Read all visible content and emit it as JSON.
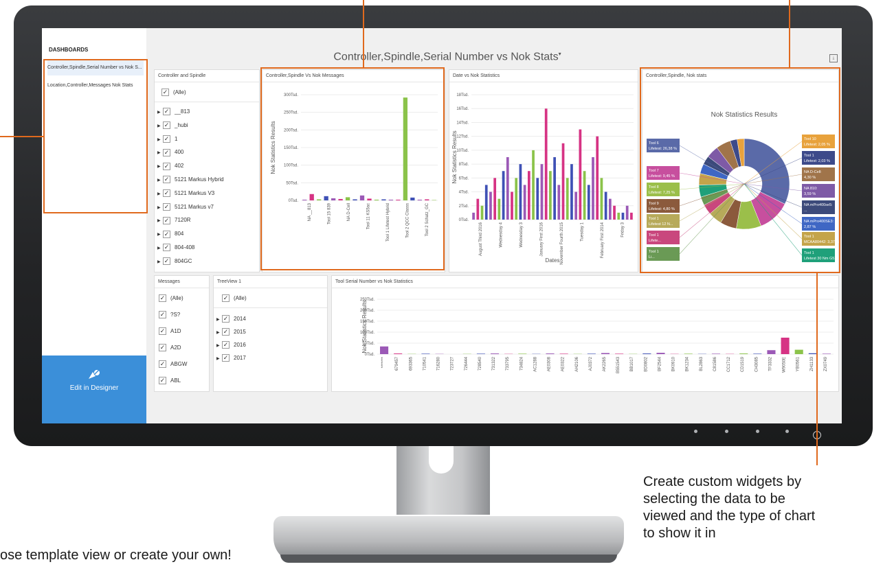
{
  "sidebar": {
    "title": "DASHBOARDS",
    "items": [
      "Controller,Spindle,Serial Number vs Nok S...",
      "Location,Controller,Messages Nok Stats"
    ],
    "edit_label": "Edit in Designer"
  },
  "main": {
    "title": "Controller,Spindle,Serial Number vs Nok Stats",
    "title_marker": "▾"
  },
  "filter_controller": {
    "header": "Controller and Spindle",
    "all_label": "(Alle)",
    "items": [
      "__813",
      "_hubi",
      "1",
      "400",
      "402",
      "5121 Markus Hybrid",
      "5121 Markus V3",
      "5121 Markus v7",
      "7120R",
      "804",
      "804-408",
      "804GC"
    ]
  },
  "filter_messages": {
    "header": "Messages",
    "items": [
      "(Alle)",
      "?S?",
      "A1D",
      "A2D",
      "ABGW",
      "ABL"
    ]
  },
  "filter_treeview": {
    "header": "TreeView 1",
    "all_label": "(Alle)",
    "items": [
      "2014",
      "2015",
      "2016",
      "2017"
    ]
  },
  "colors": {
    "accent": "#e0691d",
    "sidebar_button": "#3b8fd9",
    "c1": "#9b59b6",
    "c2": "#d63384",
    "c3": "#8bc34a",
    "c4": "#3f51b5"
  },
  "annotations": {
    "right_text": "Create custom widgets by selecting the data to be viewed and the type of chart to show it in",
    "right_lines": [
      "Create custom widgets by",
      "selecting the data to be",
      "viewed and the type of chart",
      "to show it in"
    ],
    "left_text": "ose template view or create your own!"
  },
  "chart_data": [
    {
      "type": "bar",
      "title": "Controller,Spindle Vs Nok Messages",
      "ylabel": "Nok Statistics Results",
      "ylim": [
        0,
        300
      ],
      "yticks": [
        "0Tsd.",
        "50Tsd.",
        "100Tsd.",
        "150Tsd.",
        "200Tsd.",
        "250Tsd.",
        "300Tsd."
      ],
      "xticks": [
        "NA __813",
        "Tool 15 839",
        "NA D-Cell",
        "Tool 11 KS5ac",
        "Tool 1 Lifetest Hybrid",
        "Tool 2 QCC Classs",
        "Tool 2 Schatz_GC"
      ],
      "values": [
        2,
        18,
        3,
        12,
        6,
        4,
        9,
        3,
        14,
        5,
        2,
        3,
        2,
        2,
        292,
        8,
        2,
        3,
        1
      ]
    },
    {
      "type": "bar",
      "title": "Date vs Nok Statistics",
      "xlabel": "Dates",
      "ylabel": "Nok Statistics Results",
      "ylim": [
        0,
        18
      ],
      "yticks": [
        "0Tsd.",
        "2Tsd.",
        "4Tsd.",
        "6Tsd.",
        "8Tsd.",
        "10Tsd.",
        "12Tsd.",
        "14Tsd.",
        "16Tsd.",
        "18Tsd."
      ],
      "xticks": [
        "August Third 2016",
        "Wednesday 4",
        "Wednesday 3",
        "January First 2016",
        "November Fourth 2015",
        "Tuesday 1",
        "February First 2014",
        "Friday 3"
      ],
      "values": [
        1,
        3,
        2,
        5,
        4,
        6,
        3,
        7,
        9,
        4,
        6,
        8,
        5,
        7,
        10,
        6,
        8,
        16,
        7,
        9,
        5,
        11,
        6,
        8,
        4,
        13,
        7,
        5,
        9,
        12,
        6,
        4,
        3,
        2,
        1,
        1,
        2,
        1
      ]
    },
    {
      "type": "pie",
      "title": "Nok Statistics Results",
      "panel_title": "Controller,Spindle, Nok stats",
      "slices": [
        {
          "label": "Tool 6 Lifetest: 26,38 %",
          "value": 26.38,
          "color": "#5a6aa8"
        },
        {
          "label": "Tool 7 Lifetest: 9,45 %",
          "value": 9.45,
          "color": "#c74f9e"
        },
        {
          "label": "Tool 8 Lifetest: 7,25 %",
          "value": 7.25,
          "color": "#9bbf4a"
        },
        {
          "label": "Tool 9 Lifetest: 4,80 %",
          "value": 4.8,
          "color": "#8b5a3c"
        },
        {
          "label": "Tool 1 Lifetest 12 N...",
          "value": 4.0,
          "color": "#b7aa5a"
        },
        {
          "label": "Tool 1 Lifete...",
          "value": 3.0,
          "color": "#c9477d"
        },
        {
          "label": "Tool 1 Li...",
          "value": 2.5,
          "color": "#6a9a55"
        },
        {
          "label": "Tool 1 Lifetest 30 Nm G53...",
          "value": 3.5,
          "color": "#1fa07a"
        },
        {
          "label": "Tool 1 MCAA80442: 3,37 %",
          "value": 3.37,
          "color": "#c4a44a"
        },
        {
          "label": "NA mPro400SE3: 2,87 %",
          "value": 2.87,
          "color": "#3f67c4"
        },
        {
          "label": "NA mPro400se5: ...",
          "value": 2.5,
          "color": "#3c4a7a"
        },
        {
          "label": "NA 810: 3,59 %",
          "value": 3.59,
          "color": "#7e5aa6"
        },
        {
          "label": "NA D-Cell: 4,30 %",
          "value": 4.3,
          "color": "#a0744a"
        },
        {
          "label": "Tool 1 Lifetest: 2,03 %",
          "value": 2.03,
          "color": "#3d4a8a"
        },
        {
          "label": "Tool 10 Lifetest: 2,05 %",
          "value": 2.05,
          "color": "#e8a23c"
        }
      ]
    },
    {
      "type": "bar",
      "title": "Tool Serial Number vs Nok Statistics",
      "ylabel": "Nok Statistics Results",
      "ylim": [
        0,
        250
      ],
      "yticks": [
        "0Tsd.",
        "50Tsd.",
        "100Tsd.",
        "150Tsd.",
        "200Tsd.",
        "250Tsd."
      ],
      "xticks": [
        "*******",
        "679457",
        "693365",
        "710541",
        "716280",
        "723727",
        "726444",
        "728540",
        "731322",
        "733795",
        "734824",
        "AC1288",
        "AE0308",
        "AE0322",
        "AH2106",
        "AJ0372",
        "AK2265",
        "B551543",
        "BB1017",
        "BD0802",
        "BF2544",
        "BK0910",
        "BK1234",
        "BL2863",
        "C81586",
        "CC1712",
        "CD1519",
        "CH3085",
        "TF3332",
        "W9050E",
        "YB0561",
        "ZH1133",
        "ZX0749"
      ],
      "values": [
        35,
        3,
        1,
        2,
        1,
        0,
        1,
        2,
        3,
        1,
        2,
        1,
        3,
        2,
        1,
        2,
        5,
        2,
        1,
        3,
        6,
        1,
        2,
        1,
        2,
        1,
        3,
        2,
        18,
        75,
        20,
        4,
        2
      ]
    }
  ]
}
